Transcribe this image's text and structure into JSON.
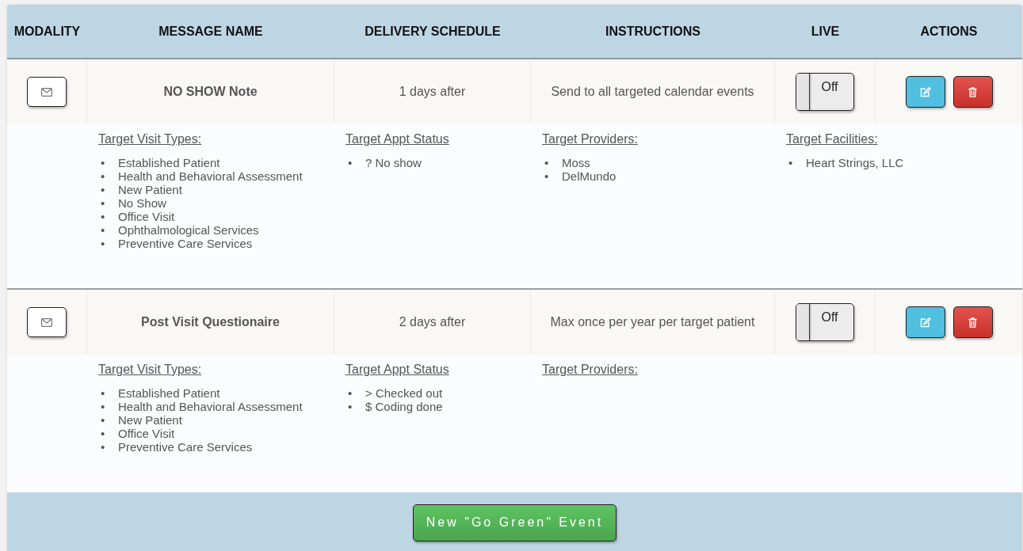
{
  "table": {
    "columns": [
      "MODALITY",
      "MESSAGE NAME",
      "DELIVERY SCHEDULE",
      "INSTRUCTIONS",
      "LIVE",
      "ACTIONS"
    ],
    "rows": [
      {
        "name": "NO SHOW Note",
        "schedule": "1 days after",
        "instructions": "Send to all targeted calendar events",
        "live": {
          "on": false,
          "label": "Off"
        },
        "details": [
          {
            "heading": "Target Visit Types:",
            "items": [
              {
                "marker": "•",
                "text": "Established Patient"
              },
              {
                "marker": "•",
                "text": "Health and Behavioral Assessment"
              },
              {
                "marker": "•",
                "text": "New Patient"
              },
              {
                "marker": "•",
                "text": "No Show"
              },
              {
                "marker": "•",
                "text": "Office Visit"
              },
              {
                "marker": "•",
                "text": "Ophthalmological Services"
              },
              {
                "marker": "•",
                "text": "Preventive Care Services"
              }
            ]
          },
          {
            "heading": "Target Appt Status",
            "items": [
              {
                "marker": "•",
                "text": "? No show"
              }
            ]
          },
          {
            "heading": "Target Providers:",
            "items": [
              {
                "marker": "•",
                "text": "Moss"
              },
              {
                "marker": "•",
                "text": "DelMundo"
              }
            ]
          },
          {
            "heading": "Target Facilities:",
            "items": [
              {
                "marker": "•",
                "text": "Heart Strings, LLC"
              }
            ]
          }
        ]
      },
      {
        "name": "Post Visit Questionaire",
        "schedule": "2 days after",
        "instructions": "Max once per year per target patient",
        "live": {
          "on": false,
          "label": "Off"
        },
        "details": [
          {
            "heading": "Target Visit Types:",
            "items": [
              {
                "marker": "•",
                "text": "Established Patient"
              },
              {
                "marker": "•",
                "text": "Health and Behavioral Assessment"
              },
              {
                "marker": "•",
                "text": "New Patient"
              },
              {
                "marker": "•",
                "text": "Office Visit"
              },
              {
                "marker": "•",
                "text": "Preventive Care Services"
              }
            ]
          },
          {
            "heading": "Target Appt Status",
            "items": [
              {
                "marker": "•",
                "text": "> Checked out"
              },
              {
                "marker": "•",
                "text": "$ Coding done"
              }
            ]
          },
          {
            "heading": "Target Providers:"
          }
        ]
      }
    ]
  },
  "footer": {
    "button": "New \"Go Green\" Event"
  }
}
